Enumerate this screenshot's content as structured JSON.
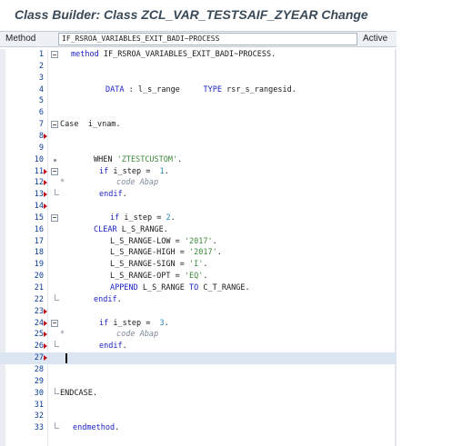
{
  "window": {
    "title": "Class Builder: Class ZCL_VAR_TESTSAIF_ZYEAR Change"
  },
  "method_bar": {
    "label": "Method",
    "value": "IF_RSROA_VARIABLES_EXIT_BADI~PROCESS",
    "status": "Active"
  },
  "editor": {
    "lines": [
      {
        "num": "1",
        "indent": 78,
        "segments": [
          {
            "t": "method",
            "c": "kw"
          },
          {
            "t": " IF_RSROA_VARIABLES_EXIT_BADI~PROCESS.",
            "c": ""
          }
        ],
        "fold": "box"
      },
      {
        "num": "2",
        "indent": 0,
        "segments": []
      },
      {
        "num": "3",
        "indent": 0,
        "segments": []
      },
      {
        "num": "4",
        "indent": 116,
        "segments": [
          {
            "t": "DATA",
            "c": "kw"
          },
          {
            "t": " : l_s_range     ",
            "c": ""
          },
          {
            "t": "TYPE",
            "c": "kw"
          },
          {
            "t": " rsr_s_rangesid.",
            "c": ""
          }
        ]
      },
      {
        "num": "5",
        "indent": 0,
        "segments": []
      },
      {
        "num": "6",
        "indent": 0,
        "segments": []
      },
      {
        "num": "7",
        "indent": 66,
        "segments": [
          {
            "t": "Case",
            "c": ""
          },
          {
            "t": "  i_vnam.",
            "c": ""
          }
        ],
        "fold": "box"
      },
      {
        "num": "8",
        "indent": 0,
        "segments": [],
        "marker": true
      },
      {
        "num": "9",
        "indent": 0,
        "segments": []
      },
      {
        "num": "10",
        "indent": 103,
        "segments": [
          {
            "t": "WHEN",
            "c": ""
          },
          {
            "t": " 'ZTESTCUSTOM'",
            "c": "str"
          },
          {
            "t": ".",
            "c": ""
          }
        ],
        "fold": "dot"
      },
      {
        "num": "11",
        "indent": 109,
        "segments": [
          {
            "t": "if",
            "c": "kw"
          },
          {
            "t": " i_step =  ",
            "c": ""
          },
          {
            "t": "1",
            "c": "num"
          },
          {
            "t": ".",
            "c": ""
          }
        ],
        "marker": true,
        "fold": "box"
      },
      {
        "num": "12",
        "indent": 128,
        "segments": [
          {
            "t": "code Abap",
            "c": "cmt"
          }
        ],
        "marker": true,
        "fold": "star"
      },
      {
        "num": "13",
        "indent": 109,
        "segments": [
          {
            "t": "endif",
            "c": "kw"
          },
          {
            "t": ".",
            "c": ""
          }
        ],
        "marker": true,
        "fold": "end"
      },
      {
        "num": "14",
        "indent": 0,
        "segments": [],
        "marker": true
      },
      {
        "num": "15",
        "indent": 121,
        "segments": [
          {
            "t": "if",
            "c": "kw"
          },
          {
            "t": " i_step = ",
            "c": ""
          },
          {
            "t": "2",
            "c": "num"
          },
          {
            "t": ".",
            "c": ""
          }
        ],
        "fold": "box"
      },
      {
        "num": "16",
        "indent": 103,
        "segments": [
          {
            "t": "CLEAR",
            "c": "kw"
          },
          {
            "t": " L_S_RANGE.",
            "c": ""
          }
        ]
      },
      {
        "num": "17",
        "indent": 121,
        "segments": [
          {
            "t": "L_S_RANGE-LOW = ",
            "c": ""
          },
          {
            "t": "'2017'",
            "c": "str"
          },
          {
            "t": ".",
            "c": ""
          }
        ]
      },
      {
        "num": "18",
        "indent": 121,
        "segments": [
          {
            "t": "L_S_RANGE-HIGH = ",
            "c": ""
          },
          {
            "t": "'2017'",
            "c": "str"
          },
          {
            "t": ".",
            "c": ""
          }
        ]
      },
      {
        "num": "19",
        "indent": 121,
        "segments": [
          {
            "t": "L_S_RANGE-SIGN = ",
            "c": ""
          },
          {
            "t": "'I'",
            "c": "str"
          },
          {
            "t": ".",
            "c": ""
          }
        ]
      },
      {
        "num": "20",
        "indent": 121,
        "segments": [
          {
            "t": "L_S_RANGE-OPT = ",
            "c": ""
          },
          {
            "t": "'EQ'",
            "c": "str"
          },
          {
            "t": ".",
            "c": ""
          }
        ]
      },
      {
        "num": "21",
        "indent": 121,
        "segments": [
          {
            "t": "APPEND",
            "c": "kw"
          },
          {
            "t": " L_S_RANGE ",
            "c": ""
          },
          {
            "t": "TO",
            "c": "kw"
          },
          {
            "t": " C_T_RANGE.",
            "c": ""
          }
        ]
      },
      {
        "num": "22",
        "indent": 103,
        "segments": [
          {
            "t": "endif",
            "c": "kw"
          },
          {
            "t": ".",
            "c": ""
          }
        ],
        "fold": "end"
      },
      {
        "num": "23",
        "indent": 0,
        "segments": [],
        "marker": true
      },
      {
        "num": "24",
        "indent": 109,
        "segments": [
          {
            "t": "if",
            "c": "kw"
          },
          {
            "t": " i_step =  ",
            "c": ""
          },
          {
            "t": "3",
            "c": "num"
          },
          {
            "t": ".",
            "c": ""
          }
        ],
        "marker": true,
        "fold": "box"
      },
      {
        "num": "25",
        "indent": 128,
        "segments": [
          {
            "t": "code Abap",
            "c": "cmt"
          }
        ],
        "marker": true,
        "fold": "star"
      },
      {
        "num": "26",
        "indent": 109,
        "segments": [
          {
            "t": "endif",
            "c": "kw"
          },
          {
            "t": ".",
            "c": ""
          }
        ],
        "marker": true,
        "fold": "end"
      },
      {
        "num": "27",
        "indent": 0,
        "segments": [],
        "marker": true,
        "active": true,
        "cursor": true
      },
      {
        "num": "28",
        "indent": 0,
        "segments": []
      },
      {
        "num": "29",
        "indent": 0,
        "segments": []
      },
      {
        "num": "30",
        "indent": 66,
        "segments": [
          {
            "t": "ENDCASE",
            "c": ""
          },
          {
            "t": ".",
            "c": ""
          }
        ],
        "fold": "end"
      },
      {
        "num": "31",
        "indent": 0,
        "segments": []
      },
      {
        "num": "32",
        "indent": 0,
        "segments": []
      },
      {
        "num": "33",
        "indent": 80,
        "segments": [
          {
            "t": "endmethod",
            "c": "kw"
          },
          {
            "t": ".",
            "c": ""
          }
        ],
        "fold": "end"
      }
    ]
  }
}
